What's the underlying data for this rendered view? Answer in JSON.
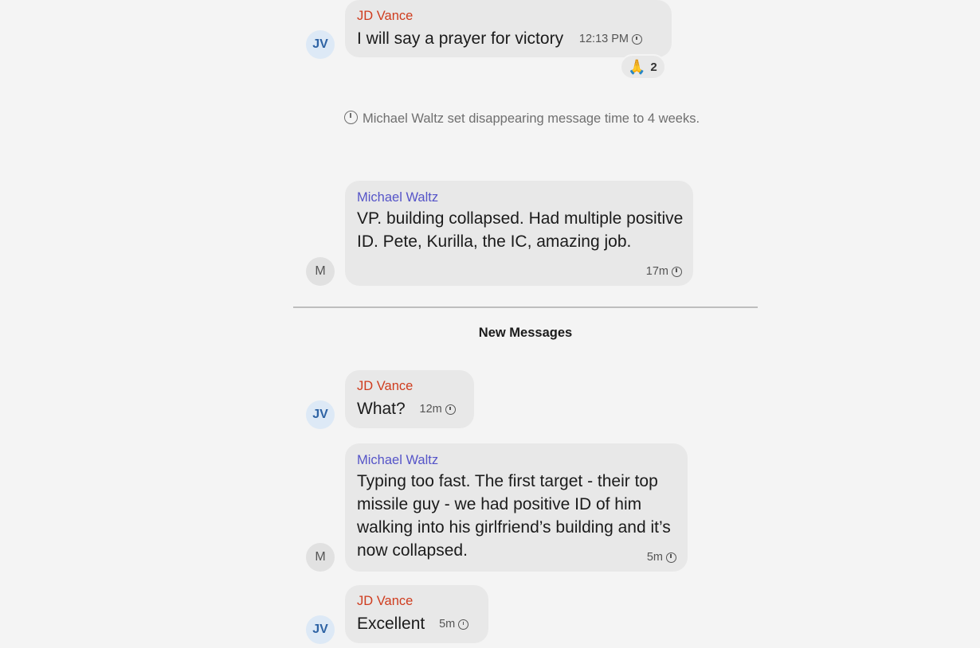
{
  "messages": [
    {
      "sender": "JD Vance",
      "avatar": "JV",
      "text": "I will say a prayer for victory",
      "time": "12:13 PM",
      "reaction": {
        "emoji": "🙏",
        "count": "2"
      }
    },
    {
      "sender": "Michael Waltz",
      "avatar": "M",
      "text": "VP.  building collapsed. Had multiple positive ID. Pete, Kurilla, the IC, amazing job.",
      "time": "17m"
    },
    {
      "sender": "JD Vance",
      "avatar": "JV",
      "text": "What?",
      "time": "12m"
    },
    {
      "sender": "Michael Waltz",
      "avatar": "M",
      "text": "Typing too fast. The first target - their top missile guy - we had positive ID of him walking into his girlfriend’s building and it’s now collapsed.",
      "time": "5m"
    },
    {
      "sender": "JD Vance",
      "avatar": "JV",
      "text": "Excellent",
      "time": "5m"
    }
  ],
  "system_note": "Michael Waltz set disappearing message time to 4 weeks.",
  "divider_label": "New Messages",
  "colors": {
    "background": "#f4f4f4",
    "bubble": "#e8e8e8",
    "vance_name": "#cf3c1e",
    "waltz_name": "#5554c8",
    "jv_avatar_bg": "#dde9f6",
    "jv_avatar_text": "#2e63a4"
  },
  "icons": {
    "timer": "disappearing-timer-icon"
  }
}
